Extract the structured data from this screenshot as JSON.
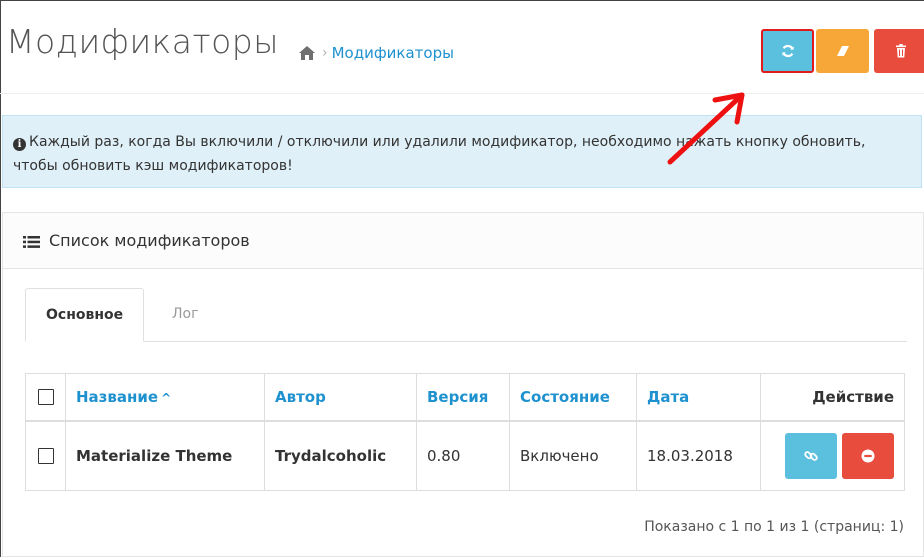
{
  "page": {
    "title": "Модификаторы",
    "breadcrumb": {
      "home_icon": "home-icon",
      "separator": "›",
      "current": "Модификаторы"
    }
  },
  "header_buttons": [
    {
      "name": "refresh-button",
      "icon": "refresh-icon",
      "color": "#5bc0de",
      "highlighted": true
    },
    {
      "name": "clear-button",
      "icon": "eraser-icon",
      "color": "#f6a737"
    },
    {
      "name": "delete-button",
      "icon": "trash-icon",
      "color": "#e74c3c"
    }
  ],
  "alert": {
    "icon": "info-circle-icon",
    "text": "Каждый раз, когда Вы включили / отключили или удалили модификатор, необходимо нажать кнопку обновить, чтобы обновить кэш модификаторов!"
  },
  "panel": {
    "icon": "list-icon",
    "title": "Список модификаторов",
    "tabs": [
      {
        "label": "Основное",
        "active": true
      },
      {
        "label": "Лог",
        "active": false
      }
    ],
    "table": {
      "columns": {
        "name": "Название",
        "author": "Автор",
        "version": "Версия",
        "status": "Состояние",
        "date": "Дата",
        "action": "Действие"
      },
      "rows": [
        {
          "name": "Materialize Theme",
          "author": "Trydalcoholic",
          "version": "0.80",
          "status": "Включено",
          "date": "18.03.2018",
          "actions": [
            {
              "name": "link-button",
              "icon": "link-icon",
              "color": "#5bc0de"
            },
            {
              "name": "disable-button",
              "icon": "minus-circle-icon",
              "color": "#e74c3c"
            }
          ]
        }
      ]
    },
    "pagination_text": "Показано с 1 по 1 из 1 (страниц: 1)"
  },
  "colors": {
    "accent": "#1e91cf",
    "alert_bg": "#dff0f8",
    "highlight_border": "#e21a1a"
  }
}
